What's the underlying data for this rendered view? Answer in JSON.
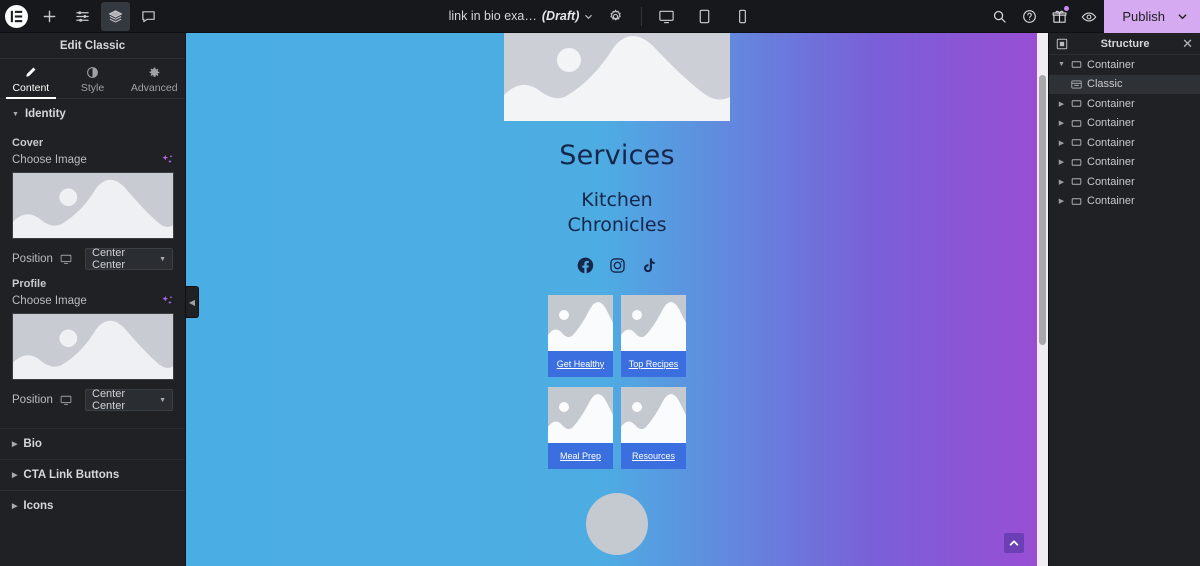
{
  "topbar": {
    "logo_icon": "elementor-logo-icon",
    "left_icons": [
      {
        "name": "add-element-icon",
        "glyph": "plus"
      },
      {
        "name": "settings-sliders-icon",
        "glyph": "sliders"
      },
      {
        "name": "layers-structure-icon",
        "glyph": "layers",
        "active": true
      },
      {
        "name": "comments-icon",
        "glyph": "comment"
      }
    ],
    "document_title": "link in bio exa…",
    "document_status": "(Draft)",
    "document_settings_icon": "gear-icon",
    "devices": [
      {
        "name": "desktop-preview",
        "glyph": "desktop"
      },
      {
        "name": "tablet-preview",
        "glyph": "tablet"
      },
      {
        "name": "mobile-preview",
        "glyph": "mobile"
      }
    ],
    "right_icons": [
      {
        "name": "search-icon"
      },
      {
        "name": "help-icon"
      },
      {
        "name": "gift-icon",
        "badge": true
      },
      {
        "name": "preview-eye-icon"
      }
    ],
    "publish_label": "Publish",
    "publish_bg": "#d6aaf0"
  },
  "panel": {
    "header": "Edit Classic",
    "tabs": [
      {
        "label": "Content",
        "icon": "pencil-icon",
        "active": true
      },
      {
        "label": "Style",
        "icon": "contrast-icon",
        "active": false
      },
      {
        "label": "Advanced",
        "icon": "gear-icon",
        "active": false
      }
    ],
    "identity": {
      "title": "Identity",
      "groups": [
        {
          "name": "Cover",
          "choose_label": "Choose Image",
          "ai_icon": "ai-sparkle-icon",
          "position_label": "Position",
          "device_icon": "desktop-icon",
          "position_value": "Center Center"
        },
        {
          "name": "Profile",
          "choose_label": "Choose Image",
          "ai_icon": "ai-sparkle-icon",
          "position_label": "Position",
          "device_icon": "desktop-icon",
          "position_value": "Center Center"
        }
      ]
    },
    "collapsed_sections": [
      {
        "label": "Bio"
      },
      {
        "label": "CTA Link Buttons"
      },
      {
        "label": "Icons"
      }
    ]
  },
  "canvas": {
    "gradient_from": "#4aade4",
    "gradient_to": "#9b4dd4",
    "site": {
      "cover_image": "mountain-placeholder",
      "title": "Services",
      "subtitle_line1": "Kitchen",
      "subtitle_line2": "Chronicles",
      "social_icons": [
        {
          "name": "facebook-icon"
        },
        {
          "name": "instagram-icon"
        },
        {
          "name": "tiktok-icon"
        }
      ],
      "cards": [
        {
          "label": "Get Healthy",
          "image": "mountain-placeholder"
        },
        {
          "label": "Top Recipes",
          "image": "mountain-placeholder"
        },
        {
          "label": "Meal Prep",
          "image": "mountain-placeholder"
        },
        {
          "label": "Resources",
          "image": "mountain-placeholder"
        }
      ],
      "card_label_bg": "#3b6fe0",
      "text_color": "#15264a"
    },
    "scroll_top_icon": "chevron-up-icon"
  },
  "structure": {
    "collapse_icon": "collapse-all-icon",
    "title": "Structure",
    "close_icon": "close-icon",
    "tree": [
      {
        "label": "Container",
        "expanded": true,
        "depth": 0,
        "selected": false
      },
      {
        "label": "Classic",
        "expanded": false,
        "depth": 1,
        "selected": true,
        "leaf": true
      },
      {
        "label": "Container",
        "expanded": false,
        "depth": 0,
        "selected": false
      },
      {
        "label": "Container",
        "expanded": false,
        "depth": 0,
        "selected": false
      },
      {
        "label": "Container",
        "expanded": false,
        "depth": 0,
        "selected": false
      },
      {
        "label": "Container",
        "expanded": false,
        "depth": 0,
        "selected": false
      },
      {
        "label": "Container",
        "expanded": false,
        "depth": 0,
        "selected": false
      },
      {
        "label": "Container",
        "expanded": false,
        "depth": 0,
        "selected": false
      }
    ]
  }
}
